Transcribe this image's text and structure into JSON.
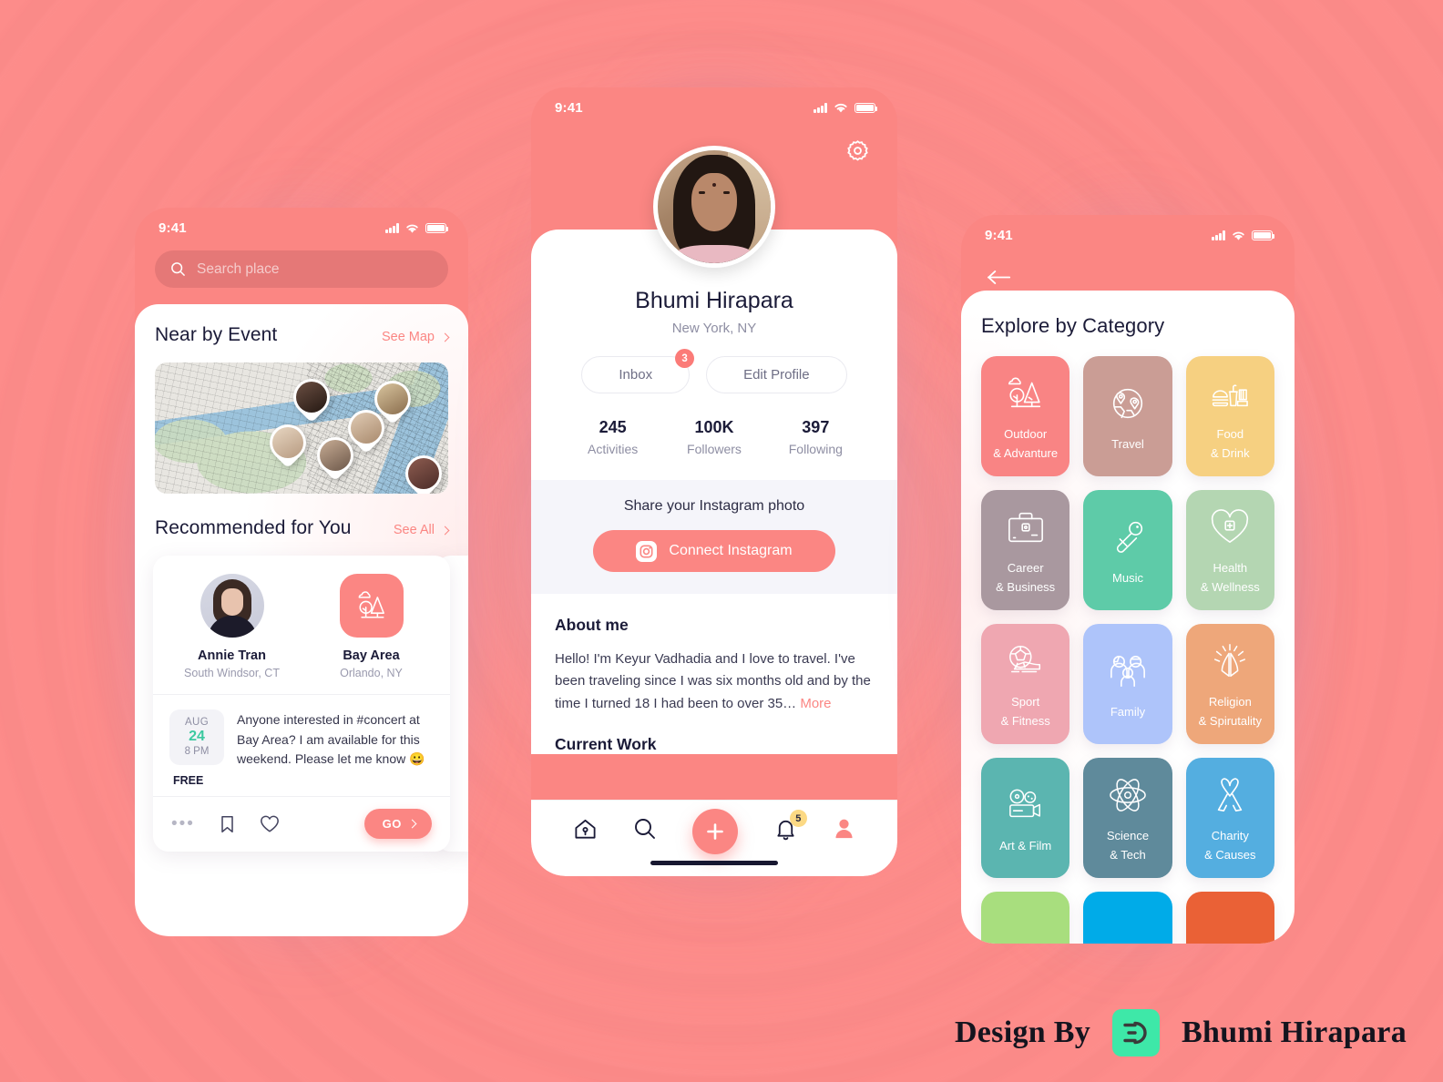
{
  "theme": {
    "background": "#FD8C8A",
    "accent": "#FB8683",
    "dark_text": "#1B1B38",
    "muted_text": "#8E8EA3",
    "teal": "#3CC9A0",
    "logo_green": "#3EE8A8"
  },
  "status_bar": {
    "time": "9:41"
  },
  "phone_left": {
    "search": {
      "placeholder": "Search place",
      "icon": "search-icon"
    },
    "nearby": {
      "title": "Near by Event",
      "link": "See Map"
    },
    "map": {
      "pins": [
        {
          "name": "pin-1",
          "color": "#3A2A25"
        },
        {
          "name": "pin-2",
          "color": "#9C8A6B"
        },
        {
          "name": "pin-3",
          "color": "#C3A58E"
        },
        {
          "name": "pin-4",
          "color": "#D9BFA6"
        },
        {
          "name": "pin-5",
          "color": "#7E6452"
        },
        {
          "name": "pin-6",
          "color": "#6B4A42"
        }
      ]
    },
    "recommended": {
      "title": "Recommended for You",
      "link": "See All"
    },
    "card": {
      "person": {
        "name": "Annie Tran",
        "location": "South Windsor, CT"
      },
      "place": {
        "name": "Bay Area",
        "location": "Orlando, NY",
        "icon": "outdoor-tree-icon"
      },
      "date": {
        "month": "AUG",
        "day": "24",
        "time": "8 PM"
      },
      "price": "FREE",
      "message": "Anyone interested in #concert at Bay Area? I am available for this weekend. Please let me know 😀",
      "actions": {
        "more": "•••",
        "bookmark": "bookmark-icon",
        "like": "heart-icon",
        "go": "GO"
      }
    }
  },
  "phone_mid": {
    "settings_icon": "gear-icon",
    "profile": {
      "name": "Bhumi Hirapara",
      "location": "New York, NY",
      "avatar": "profile-photo"
    },
    "buttons": {
      "inbox": "Inbox",
      "inbox_badge": "3",
      "edit": "Edit Profile"
    },
    "stats": [
      {
        "value": "245",
        "label": "Activities"
      },
      {
        "value": "100K",
        "label": "Followers"
      },
      {
        "value": "397",
        "label": "Following"
      }
    ],
    "instagram": {
      "prompt": "Share your Instagram photo",
      "button": "Connect Instagram",
      "icon": "instagram-icon"
    },
    "about": {
      "heading": "About me",
      "text": "Hello! I'm Keyur Vadhadia and I love to travel. I've been traveling since I was six months old and by the time I turned 18 I had been to over 35…",
      "more": "More",
      "work_heading": "Current Work"
    },
    "tabbar": [
      {
        "name": "home-icon",
        "badge": null
      },
      {
        "name": "search-icon",
        "badge": null
      },
      {
        "name": "add-icon",
        "badge": null
      },
      {
        "name": "bell-icon",
        "badge": "5"
      },
      {
        "name": "profile-icon",
        "badge": null
      }
    ]
  },
  "phone_right": {
    "back_icon": "back-arrow-icon",
    "title": "Explore by Category",
    "categories": [
      {
        "label": "Outdoor\n& Advanture",
        "line1": "Outdoor",
        "line2": "& Advanture",
        "color": "#F98484",
        "icon": "tree-cloud-icon"
      },
      {
        "label": "Travel",
        "line1": "Travel",
        "line2": "",
        "color": "#CA9D95",
        "icon": "globe-pin-icon"
      },
      {
        "label": "Food\n& Drink",
        "line1": "Food",
        "line2": "& Drink",
        "color": "#F6D081",
        "icon": "burger-drink-icon"
      },
      {
        "label": "Career\n& Business",
        "line1": "Career",
        "line2": "& Business",
        "color": "#A9989F",
        "icon": "briefcase-icon"
      },
      {
        "label": "Music",
        "line1": "Music",
        "line2": "",
        "color": "#5ECBA8",
        "icon": "microphone-icon"
      },
      {
        "label": "Health\n& Wellness",
        "line1": "Health",
        "line2": "& Wellness",
        "color": "#B4D6B2",
        "icon": "heart-plus-icon"
      },
      {
        "label": "Sport\n& Fitness",
        "line1": "Sport",
        "line2": "& Fitness",
        "color": "#EFA7B1",
        "icon": "soccer-shoe-icon"
      },
      {
        "label": "Family",
        "line1": "Family",
        "line2": "",
        "color": "#AEC4FA",
        "icon": "family-icon"
      },
      {
        "label": "Religion\n& Spirutality",
        "line1": "Religion",
        "line2": "& Spirutality",
        "color": "#EEA77A",
        "icon": "praying-hands-icon"
      },
      {
        "label": "Art & Film",
        "line1": "Art & Film",
        "line2": "",
        "color": "#5BB5B0",
        "icon": "film-camera-icon"
      },
      {
        "label": "Science\n& Tech",
        "line1": "Science",
        "line2": "& Tech",
        "color": "#5F8A9B",
        "icon": "atom-icon"
      },
      {
        "label": "Charity\n& Causes",
        "line1": "Charity",
        "line2": "& Causes",
        "color": "#54AEE0",
        "icon": "ribbon-icon"
      }
    ],
    "partial_row_colors": [
      "#A8DE7E",
      "#00ABE8",
      "#EA6136"
    ]
  },
  "footer": {
    "design_by": "Design By",
    "author": "Bhumi Hirapara",
    "logo": "bd-logo-icon"
  }
}
